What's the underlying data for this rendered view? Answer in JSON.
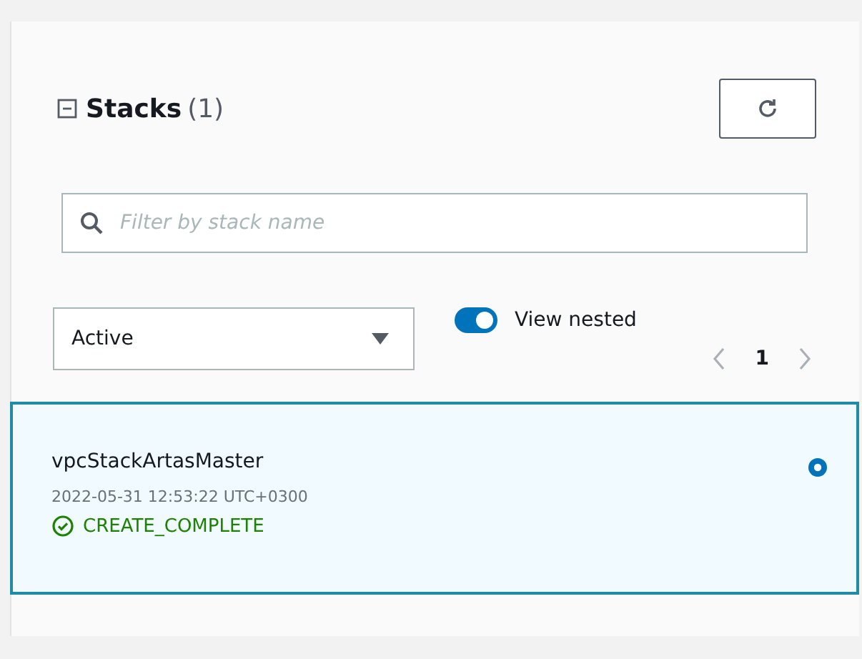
{
  "header": {
    "title": "Stacks",
    "count": "(1)",
    "expanded": true
  },
  "search": {
    "placeholder": "Filter by stack name"
  },
  "filter": {
    "value": "Active"
  },
  "view_nested": {
    "label": "View nested",
    "on": true
  },
  "pagination": {
    "page": "1"
  },
  "stacks": [
    {
      "name": "vpcStackArtasMaster",
      "time": "2022-05-31 12:53:22 UTC+0300",
      "status": "CREATE_COMPLETE",
      "kind": "complete",
      "selected": true
    }
  ]
}
